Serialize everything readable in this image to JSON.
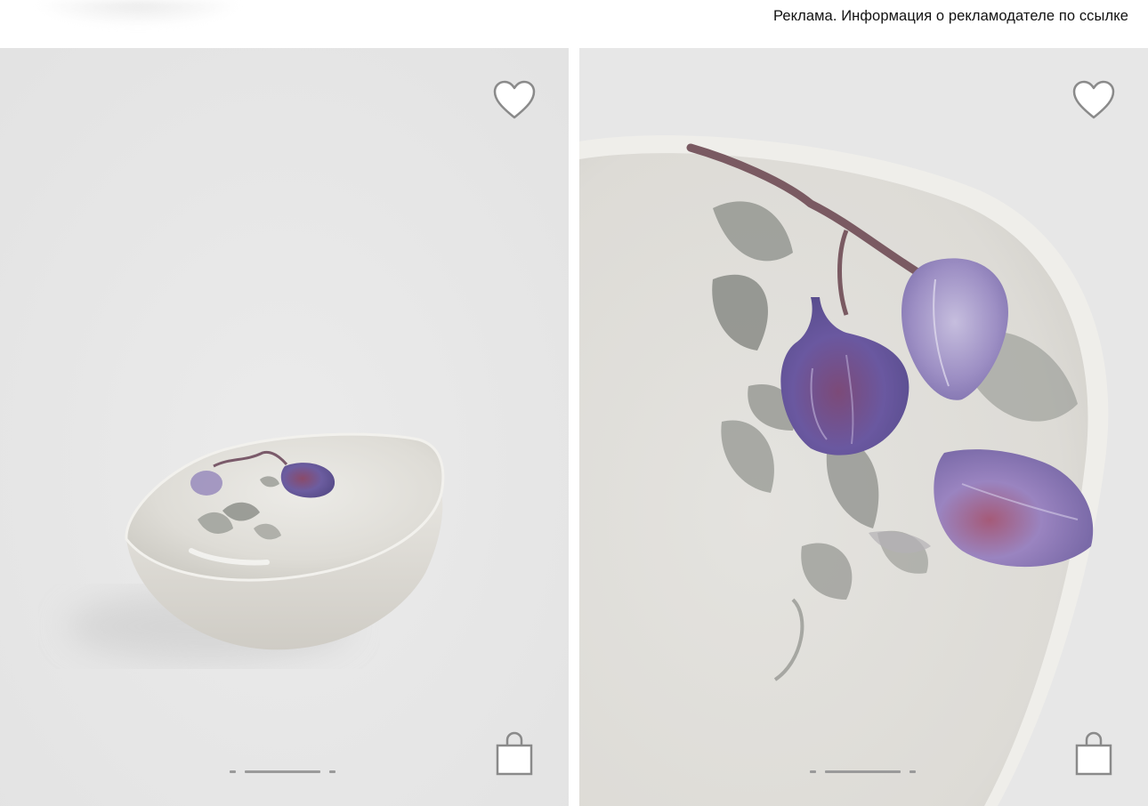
{
  "ad_notice": {
    "text": "Реклама. Информация о рекламодателе по ссылке"
  },
  "products": [
    {
      "image": "bowl-with-fig-print",
      "icons": {
        "favorite": "heart-icon",
        "cart": "shopping-bag-icon"
      },
      "carousel": {
        "slides": 3,
        "active": 2
      }
    },
    {
      "image": "bowl-closeup-fig-print",
      "icons": {
        "favorite": "heart-icon",
        "cart": "shopping-bag-icon"
      },
      "carousel": {
        "slides": 3,
        "active": 2
      }
    }
  ],
  "colors": {
    "card_background": "#e8e8e8",
    "icon_stroke": "#8a8a8a",
    "fig_purple": "#6f5ea0",
    "leaf_gray": "#8c8f88"
  }
}
